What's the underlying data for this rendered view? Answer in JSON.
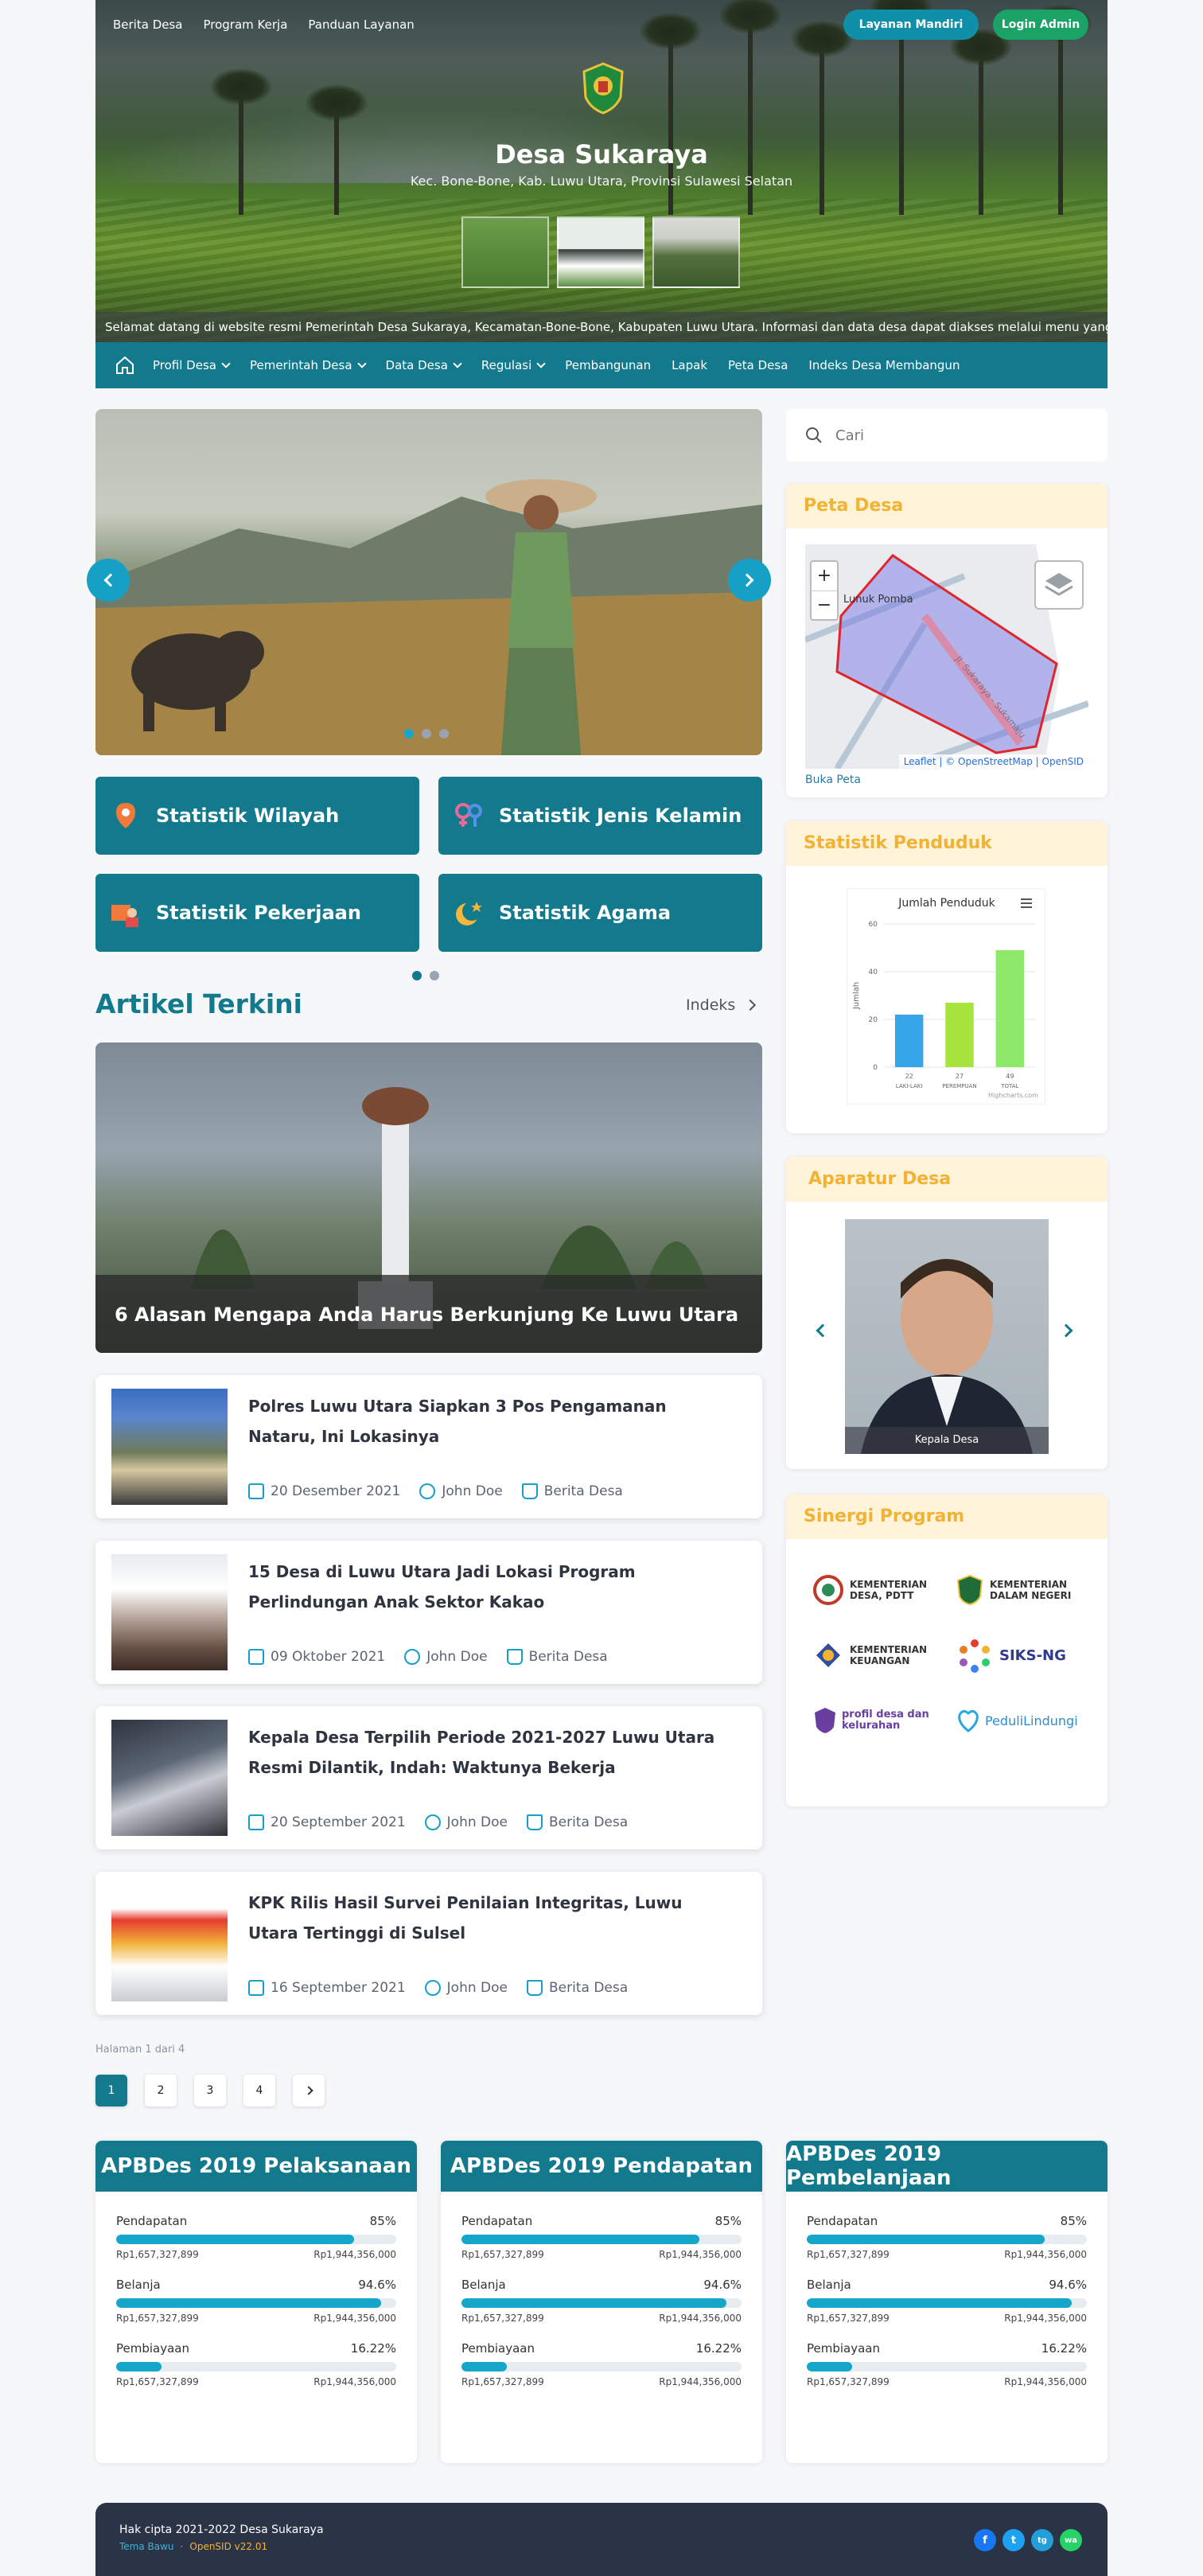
{
  "header": {
    "top_links": [
      "Berita Desa",
      "Program Kerja",
      "Panduan Layanan"
    ],
    "layanan_button": "Layanan Mandiri",
    "login_button": "Login Admin",
    "title": "Desa Sukaraya",
    "subtitle": "Kec. Bone-Bone, Kab. Luwu Utara, Provinsi Sulawesi Selatan",
    "marquee": "Selamat datang di website resmi Pemerintah Desa Sukaraya, Kecamatan-Bone-Bone, Kabupaten Luwu Utara. Informasi dan data desa dapat diakses melalui menu yang"
  },
  "nav": {
    "items": [
      {
        "label": "Profil Desa",
        "dropdown": true
      },
      {
        "label": "Pemerintah Desa",
        "dropdown": true
      },
      {
        "label": "Data Desa",
        "dropdown": true
      },
      {
        "label": "Regulasi",
        "dropdown": true
      },
      {
        "label": "Pembangunan",
        "dropdown": false
      },
      {
        "label": "Lapak",
        "dropdown": false
      },
      {
        "label": "Peta Desa",
        "dropdown": false
      },
      {
        "label": "Indeks Desa Membangun",
        "dropdown": false
      }
    ]
  },
  "stats": {
    "buttons": [
      "Statistik Wilayah",
      "Statistik Jenis Kelamin",
      "Statistik Pekerjaan",
      "Statistik Agama"
    ]
  },
  "articles": {
    "section_title": "Artikel Terkini",
    "index_link": "Indeks",
    "featured_title": "6 Alasan Mengapa Anda Harus Berkunjung Ke Luwu Utara",
    "list": [
      {
        "title": "Polres Luwu Utara Siapkan 3 Pos Pengamanan Nataru, Ini Lokasinya",
        "date": "20 Desember 2021",
        "author": "John Doe",
        "category": "Berita Desa"
      },
      {
        "title": "15 Desa di Luwu Utara Jadi Lokasi Program Perlindungan Anak Sektor Kakao",
        "date": "09 Oktober 2021",
        "author": "John Doe",
        "category": "Berita Desa"
      },
      {
        "title": "Kepala Desa Terpilih Periode 2021-2027 Luwu Utara Resmi Dilantik, Indah: Waktunya Bekerja",
        "date": "20 September 2021",
        "author": "John Doe",
        "category": "Berita Desa"
      },
      {
        "title": "KPK Rilis Hasil Survei Penilaian Integritas, Luwu Utara Tertinggi di Sulsel",
        "date": "16 September 2021",
        "author": "John Doe",
        "category": "Berita Desa"
      }
    ],
    "page_info": "Halaman 1 dari 4",
    "pages": [
      "1",
      "2",
      "3",
      "4"
    ]
  },
  "sidebar": {
    "search_placeholder": "Cari",
    "peta": {
      "title": "Peta Desa",
      "place": "Lunuk Pomba",
      "road": "Jl. Sukaraya - Sukamaju",
      "attribution": "Leaflet | © OpenStreetMap | OpenSID",
      "link": "Buka Peta"
    },
    "statistik": {
      "title": "Statistik Penduduk"
    },
    "aparatur": {
      "title": "Aparatur Desa",
      "caption": "Kepala Desa"
    },
    "sinergi": {
      "title": "Sinergi Program",
      "logos": [
        "KEMENTERIAN DESA, PDTT",
        "KEMENTERIAN DALAM NEGERI",
        "KEMENTERIAN KEUANGAN",
        "SIKS-NG",
        "profil desa dan kelurahan",
        "PeduliLindungi"
      ]
    }
  },
  "chart_data": {
    "type": "bar",
    "title": "Jumlah Penduduk",
    "ylabel": "Jumlah",
    "categories": [
      "LAKI-LAKI",
      "PEREMPUAN",
      "TOTAL"
    ],
    "values": [
      22,
      27,
      49
    ],
    "yticks": [
      "0",
      "20",
      "40",
      "60"
    ],
    "ylim": [
      0,
      60
    ],
    "colors": [
      "#36a6e8",
      "#a6e33d",
      "#8ee86a"
    ],
    "credit": "Highcharts.com"
  },
  "apbdes": [
    {
      "title": "APBDes 2019 Pelaksanaan",
      "rows": [
        {
          "label": "Pendapatan",
          "percent": "85%",
          "fill": 0.85,
          "left": "Rp1,657,327,899",
          "right": "Rp1,944,356,000"
        },
        {
          "label": "Belanja",
          "percent": "94.6%",
          "fill": 0.946,
          "left": "Rp1,657,327,899",
          "right": "Rp1,944,356,000"
        },
        {
          "label": "Pembiayaan",
          "percent": "16.22%",
          "fill": 0.1622,
          "left": "Rp1,657,327,899",
          "right": "Rp1,944,356,000"
        }
      ]
    },
    {
      "title": "APBDes 2019 Pendapatan",
      "rows": [
        {
          "label": "Pendapatan",
          "percent": "85%",
          "fill": 0.85,
          "left": "Rp1,657,327,899",
          "right": "Rp1,944,356,000"
        },
        {
          "label": "Belanja",
          "percent": "94.6%",
          "fill": 0.946,
          "left": "Rp1,657,327,899",
          "right": "Rp1,944,356,000"
        },
        {
          "label": "Pembiayaan",
          "percent": "16.22%",
          "fill": 0.1622,
          "left": "Rp1,657,327,899",
          "right": "Rp1,944,356,000"
        }
      ]
    },
    {
      "title": "APBDes 2019 Pembelanjaan",
      "rows": [
        {
          "label": "Pendapatan",
          "percent": "85%",
          "fill": 0.85,
          "left": "Rp1,657,327,899",
          "right": "Rp1,944,356,000"
        },
        {
          "label": "Belanja",
          "percent": "94.6%",
          "fill": 0.946,
          "left": "Rp1,657,327,899",
          "right": "Rp1,944,356,000"
        },
        {
          "label": "Pembiayaan",
          "percent": "16.22%",
          "fill": 0.1622,
          "left": "Rp1,657,327,899",
          "right": "Rp1,944,356,000"
        }
      ]
    }
  ],
  "footer": {
    "copyright": "Hak cipta 2021-2022 Desa Sukaraya",
    "theme": "Tema Bawu",
    "version": "OpenSID v22.01",
    "social": [
      "f",
      "t",
      "tg",
      "wa"
    ]
  },
  "colors": {
    "primary": "#137a8d",
    "accent": "#16a6c9",
    "card_header_bg": "#fff3d9",
    "card_header_text": "#f2b233",
    "login": "#1aa267"
  }
}
